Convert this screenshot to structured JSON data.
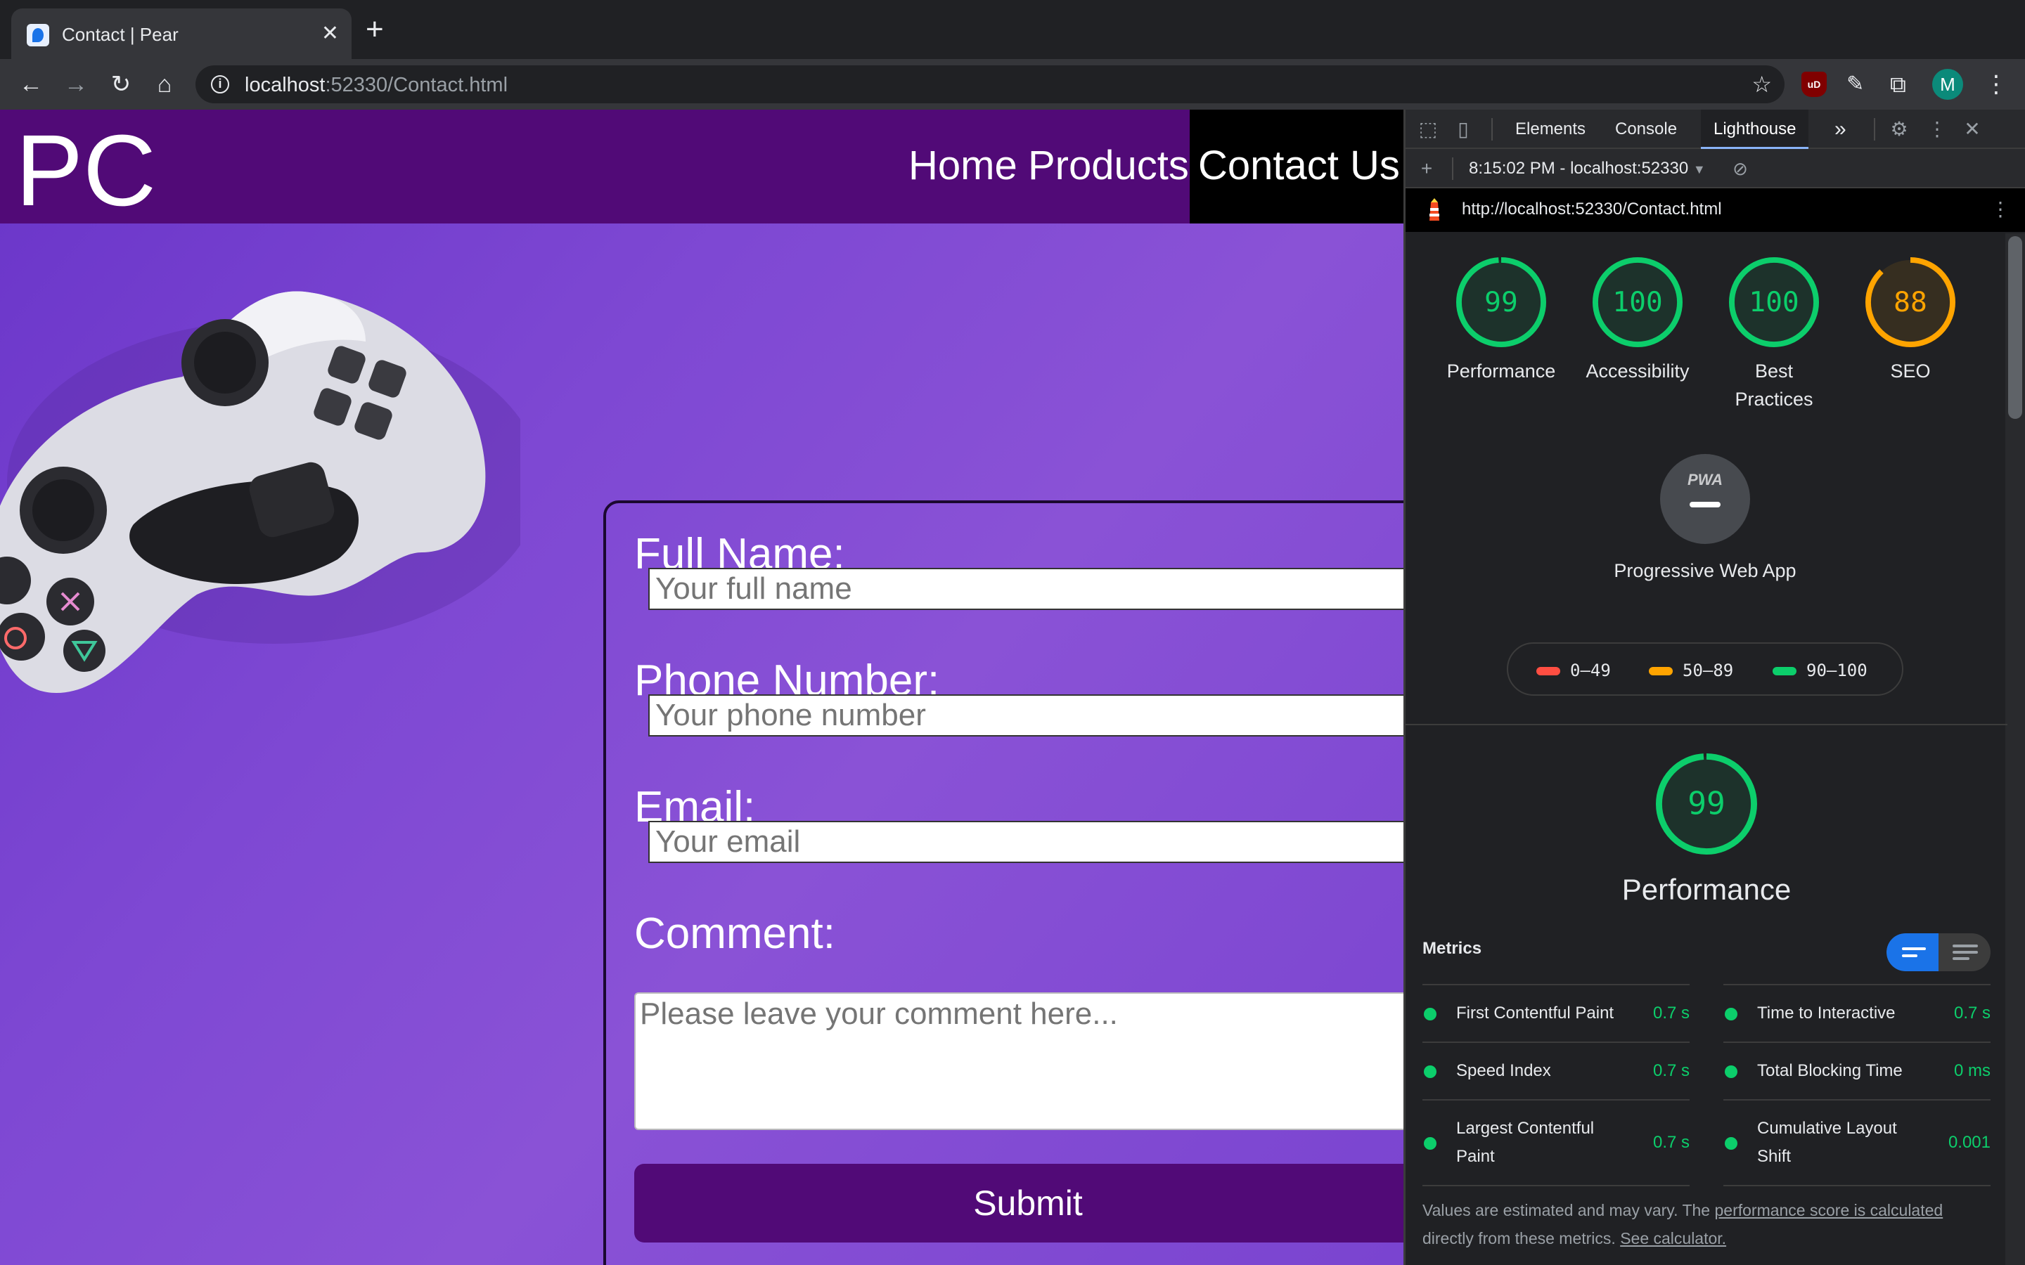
{
  "browser": {
    "tab_title": "Contact | Pear",
    "new_tab": "+",
    "url_host": "localhost",
    "url_rest": ":52330/Contact.html",
    "avatar_letter": "M",
    "ext_ublock": "uD"
  },
  "site": {
    "logo": "PC",
    "nav": {
      "home": "Home",
      "products": "Products",
      "contact": "Contact Us"
    },
    "form": {
      "name_label": "Full Name:",
      "name_placeholder": "Your full name",
      "phone_label": "Phone Number:",
      "phone_placeholder": "Your phone number",
      "email_label": "Email:",
      "email_placeholder": "Your email",
      "comment_label": "Comment:",
      "comment_placeholder": "Please leave your comment here...",
      "submit": "Submit"
    }
  },
  "devtools": {
    "tabs": [
      "Elements",
      "Console",
      "Lighthouse"
    ],
    "more": "»",
    "report_time": "8:15:02 PM - localhost:52330",
    "report_url": "http://localhost:52330/Contact.html",
    "scores": [
      {
        "value": "99",
        "label": "Performance",
        "pct": 0.99,
        "color": "#0cce6b"
      },
      {
        "value": "100",
        "label": "Accessibility",
        "pct": 1.0,
        "color": "#0cce6b"
      },
      {
        "value": "100",
        "label": "Best Practices",
        "pct": 1.0,
        "color": "#0cce6b"
      },
      {
        "value": "88",
        "label": "SEO",
        "pct": 0.88,
        "color": "#ffa400"
      }
    ],
    "pwa": {
      "badge": "PWA",
      "label": "Progressive Web App"
    },
    "legend": [
      {
        "range": "0–49",
        "color": "#ff4e42"
      },
      {
        "range": "50–89",
        "color": "#ffa400"
      },
      {
        "range": "90–100",
        "color": "#0cce6b"
      }
    ],
    "performance": {
      "value": "99",
      "title": "Performance",
      "pct": 0.99
    },
    "metrics_heading": "Metrics",
    "metrics": [
      {
        "name": "First Contentful Paint",
        "value": "0.7 s"
      },
      {
        "name": "Time to Interactive",
        "value": "0.7 s"
      },
      {
        "name": "Speed Index",
        "value": "0.7 s"
      },
      {
        "name": "Total Blocking Time",
        "value": "0 ms"
      },
      {
        "name": "Largest Contentful Paint",
        "value": "0.7 s"
      },
      {
        "name": "Cumulative Layout Shift",
        "value": "0.001"
      }
    ],
    "footnote": {
      "text1": "Values are estimated and may vary. The ",
      "link1": "performance score is calculated",
      "text2": "directly from these metrics. ",
      "link2": "See calculator."
    }
  }
}
